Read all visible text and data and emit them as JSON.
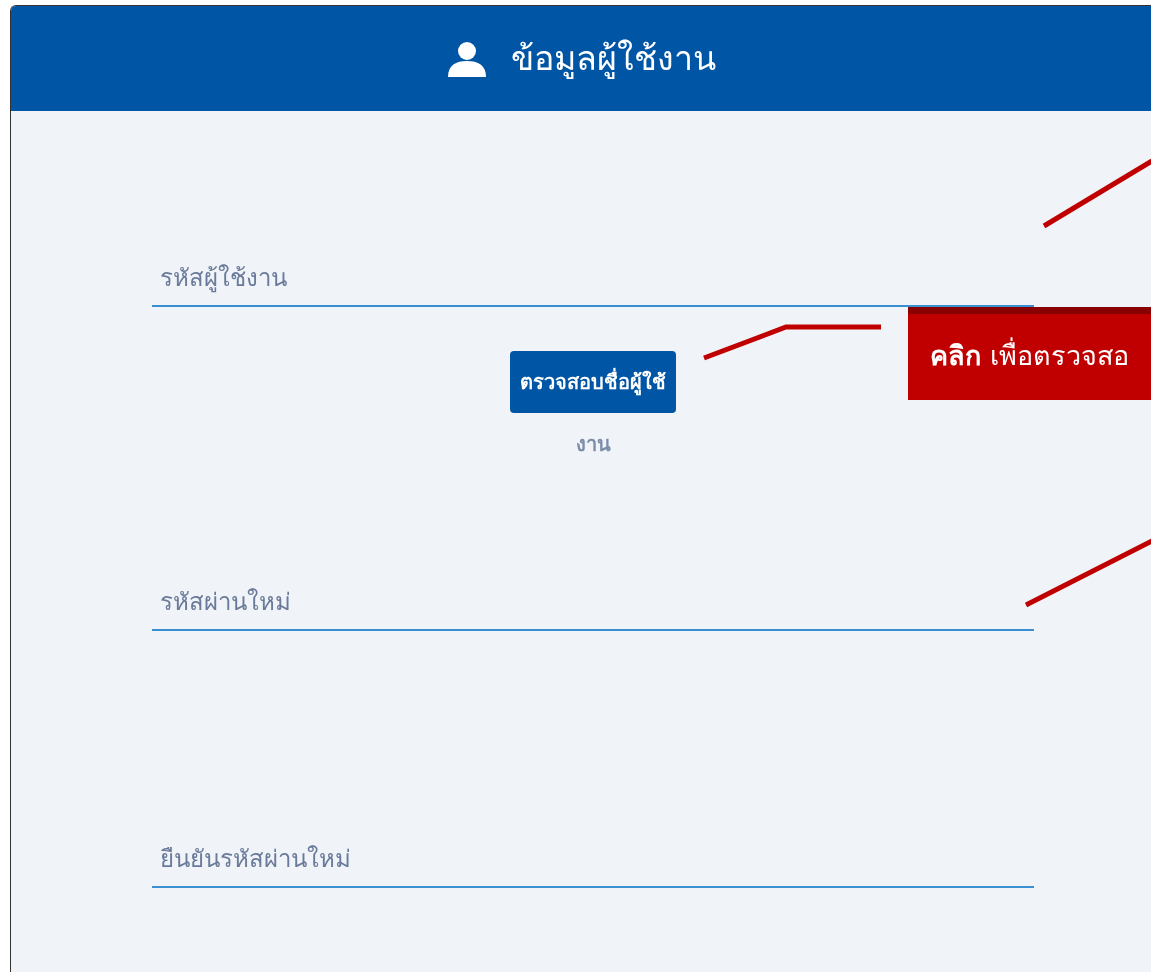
{
  "header": {
    "title": "ข้อมูลผู้ใช้งาน"
  },
  "fields": [
    {
      "placeholder": "รหัสผู้ใช้งาน"
    },
    {
      "placeholder": "รหัสผ่านใหม่"
    },
    {
      "placeholder": "ยืนยันรหัสผ่านใหม่"
    }
  ],
  "check_button": {
    "label": "ตรวจสอบชื่อผู้ใช้",
    "label_overflow": "งาน"
  },
  "callout": {
    "text": "**คลิก** เพื่อตรวจสอ"
  }
}
